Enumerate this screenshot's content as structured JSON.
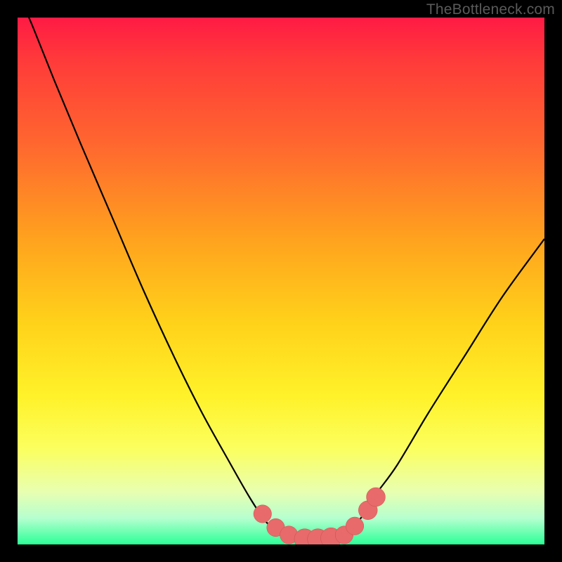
{
  "watermark": {
    "text": "TheBottleneck.com"
  },
  "colors": {
    "curve_stroke": "#000000",
    "marker_fill": "#e86a6a",
    "marker_stroke": "#c94f4f",
    "frame": "#000000"
  },
  "chart_data": {
    "type": "line",
    "title": "",
    "xlabel": "",
    "ylabel": "",
    "xlim": [
      0,
      100
    ],
    "ylim": [
      0,
      100
    ],
    "series": [
      {
        "name": "bottleneck-curve",
        "x": [
          0,
          3,
          7,
          12,
          18,
          24,
          30,
          35,
          40,
          44,
          47,
          49.5,
          52,
          55,
          58,
          62,
          65,
          68,
          72,
          78,
          85,
          92,
          100
        ],
        "y": [
          105,
          98,
          88,
          76,
          62,
          48,
          35,
          25,
          16,
          9,
          4.5,
          2.2,
          1.2,
          1.0,
          1.2,
          2.0,
          4.8,
          9.5,
          15,
          25,
          36,
          47,
          58
        ]
      }
    ],
    "markers": [
      {
        "x": 46.5,
        "y": 5.8,
        "r": 1.3
      },
      {
        "x": 49.0,
        "y": 3.2,
        "r": 1.3
      },
      {
        "x": 51.5,
        "y": 1.8,
        "r": 1.3
      },
      {
        "x": 54.5,
        "y": 1.0,
        "r": 1.6
      },
      {
        "x": 57.0,
        "y": 1.0,
        "r": 1.6
      },
      {
        "x": 59.5,
        "y": 1.2,
        "r": 1.6
      },
      {
        "x": 62.0,
        "y": 1.8,
        "r": 1.3
      },
      {
        "x": 64.0,
        "y": 3.5,
        "r": 1.3
      },
      {
        "x": 66.5,
        "y": 6.5,
        "r": 1.4
      },
      {
        "x": 68.0,
        "y": 9.0,
        "r": 1.4
      }
    ]
  }
}
